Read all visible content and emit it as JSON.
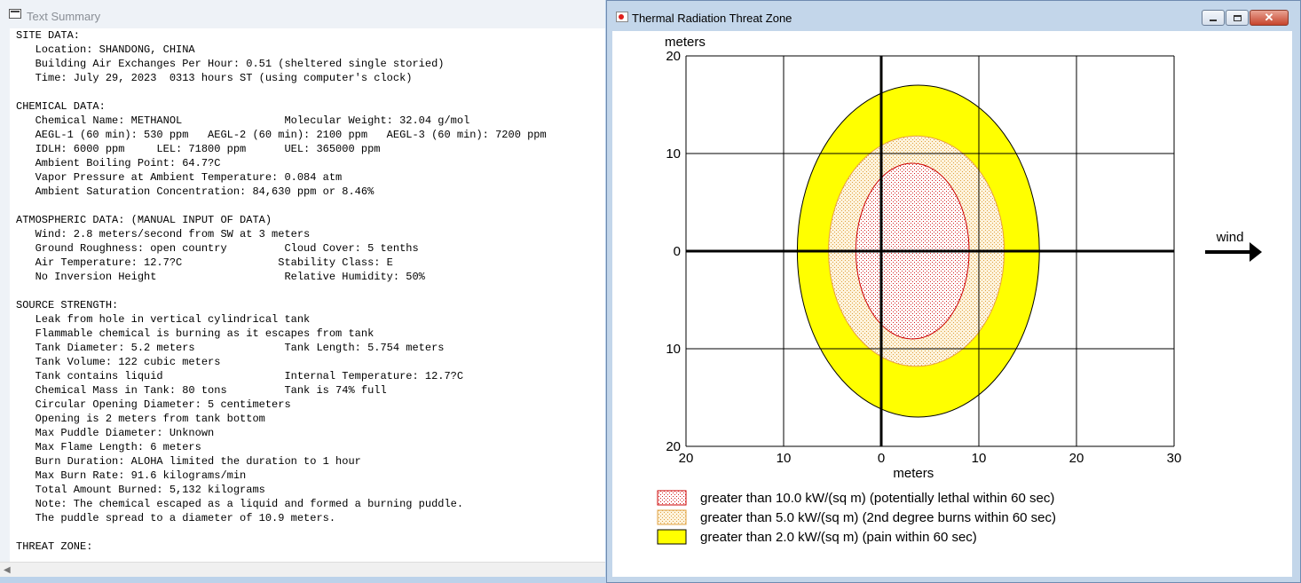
{
  "left_window": {
    "title": "Text Summary",
    "summary_text": "SITE DATA:\n   Location: SHANDONG, CHINA\n   Building Air Exchanges Per Hour: 0.51 (sheltered single storied)\n   Time: July 29, 2023  0313 hours ST (using computer's clock)\n\nCHEMICAL DATA:\n   Chemical Name: METHANOL                Molecular Weight: 32.04 g/mol\n   AEGL-1 (60 min): 530 ppm   AEGL-2 (60 min): 2100 ppm   AEGL-3 (60 min): 7200 ppm\n   IDLH: 6000 ppm     LEL: 71800 ppm      UEL: 365000 ppm\n   Ambient Boiling Point: 64.7?C\n   Vapor Pressure at Ambient Temperature: 0.084 atm\n   Ambient Saturation Concentration: 84,630 ppm or 8.46%\n\nATMOSPHERIC DATA: (MANUAL INPUT OF DATA)\n   Wind: 2.8 meters/second from SW at 3 meters\n   Ground Roughness: open country         Cloud Cover: 5 tenths\n   Air Temperature: 12.7?C               Stability Class: E\n   No Inversion Height                    Relative Humidity: 50%\n\nSOURCE STRENGTH:\n   Leak from hole in vertical cylindrical tank\n   Flammable chemical is burning as it escapes from tank\n   Tank Diameter: 5.2 meters              Tank Length: 5.754 meters\n   Tank Volume: 122 cubic meters\n   Tank contains liquid                   Internal Temperature: 12.7?C\n   Chemical Mass in Tank: 80 tons         Tank is 74% full\n   Circular Opening Diameter: 5 centimeters\n   Opening is 2 meters from tank bottom\n   Max Puddle Diameter: Unknown\n   Max Flame Length: 6 meters\n   Burn Duration: ALOHA limited the duration to 1 hour\n   Max Burn Rate: 91.6 kilograms/min\n   Total Amount Burned: 5,132 kilograms\n   Note: The chemical escaped as a liquid and formed a burning puddle.\n   The puddle spread to a diameter of 10.9 meters.\n\nTHREAT ZONE:"
  },
  "right_window": {
    "title": "Thermal Radiation Threat Zone",
    "buttons": {
      "minimize": "",
      "maximize": "",
      "close": "✕"
    }
  },
  "chart_data": {
    "type": "area",
    "title": "",
    "xlabel": "meters",
    "ylabel": "meters",
    "xlim": [
      -20,
      30
    ],
    "ylim": [
      -20,
      20
    ],
    "x_tick_labels": [
      "20",
      "10",
      "0",
      "10",
      "20",
      "30"
    ],
    "x_tick_values": [
      -20,
      -10,
      0,
      10,
      20,
      30
    ],
    "y_tick_labels": [
      "20",
      "10",
      "0",
      "10",
      "20"
    ],
    "y_tick_values": [
      20,
      10,
      0,
      -10,
      -20
    ],
    "grid": true,
    "wind_label": "wind",
    "zones": [
      {
        "name": "greater than 2.0 kW/(sq m) (pain within 60 sec)",
        "center_x": 3.8,
        "center_y": 0,
        "radius_x": 12.4,
        "radius_y": 17.0,
        "fill": "#ffff00",
        "stroke": "#000000",
        "pattern": "solid"
      },
      {
        "name": "greater than 5.0 kW/(sq m) (2nd degree burns within 60 sec)",
        "center_x": 3.6,
        "center_y": 0,
        "radius_x": 9.0,
        "radius_y": 11.8,
        "fill": "#f5e6c6",
        "stroke": "#e8a040",
        "pattern": "dots-orange"
      },
      {
        "name": "greater than 10.0 kW/(sq m) (potentially lethal within 60 sec)",
        "center_x": 3.2,
        "center_y": 0,
        "radius_x": 5.8,
        "radius_y": 9.0,
        "fill": "#fde8e8",
        "stroke": "#cc0000",
        "pattern": "dots-red"
      }
    ],
    "legend": [
      {
        "label": "greater than 10.0 kW/(sq m) (potentially lethal within 60 sec)",
        "pattern": "dots-red"
      },
      {
        "label": "greater than 5.0 kW/(sq m) (2nd degree burns within 60 sec)",
        "pattern": "dots-orange"
      },
      {
        "label": "greater than 2.0 kW/(sq m) (pain within 60 sec)",
        "pattern": "solid-yellow"
      }
    ],
    "legend_position": "bottom"
  }
}
